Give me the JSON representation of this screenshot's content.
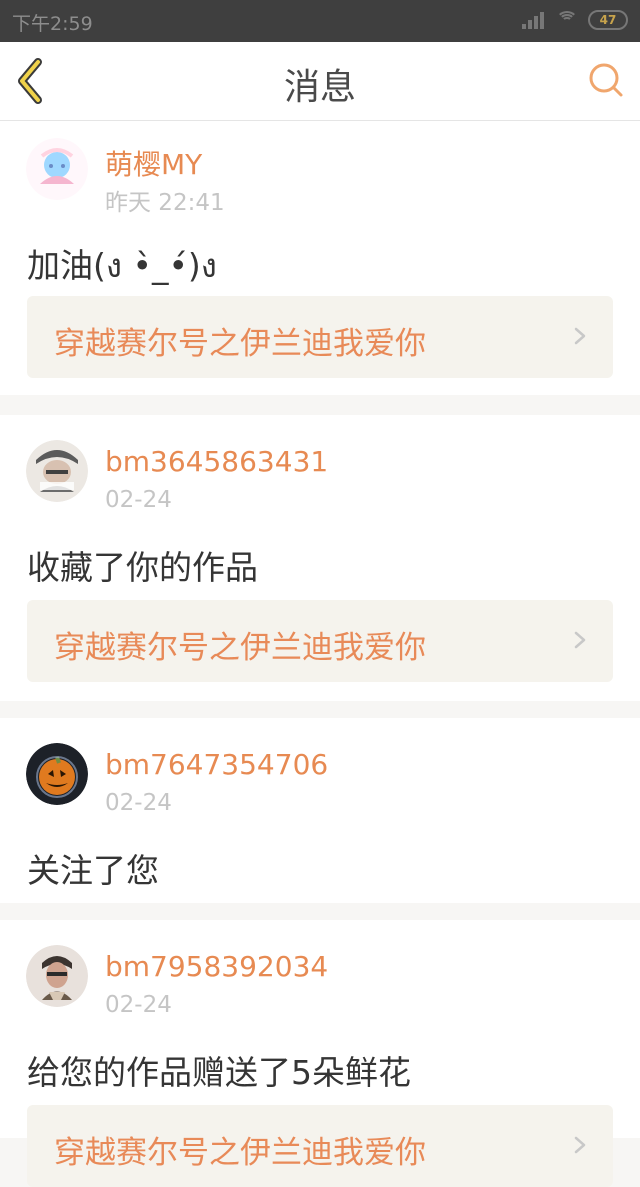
{
  "status_bar": {
    "time": "下午2:59",
    "battery": "47"
  },
  "header": {
    "title": "消息",
    "back_icon": "back-icon",
    "search_icon": "search-icon"
  },
  "messages": [
    {
      "username": "萌樱MY",
      "time": "昨天 22:41",
      "text": "加油(ง •̀_•́)ง",
      "work_title": "穿越赛尔号之伊兰迪我爱你"
    },
    {
      "username": "bm3645863431",
      "time": "02-24",
      "text": "收藏了你的作品",
      "work_title": "穿越赛尔号之伊兰迪我爱你"
    },
    {
      "username": "bm7647354706",
      "time": "02-24",
      "text": "关注了您"
    },
    {
      "username": "bm7958392034",
      "time": "02-24",
      "text": "给您的作品赠送了5朵鲜花",
      "work_title": "穿越赛尔号之伊兰迪我爱你"
    }
  ],
  "colors": {
    "accent": "#e78a52",
    "header_bg": "#ffffff",
    "page_bg": "#f7f6f4"
  }
}
